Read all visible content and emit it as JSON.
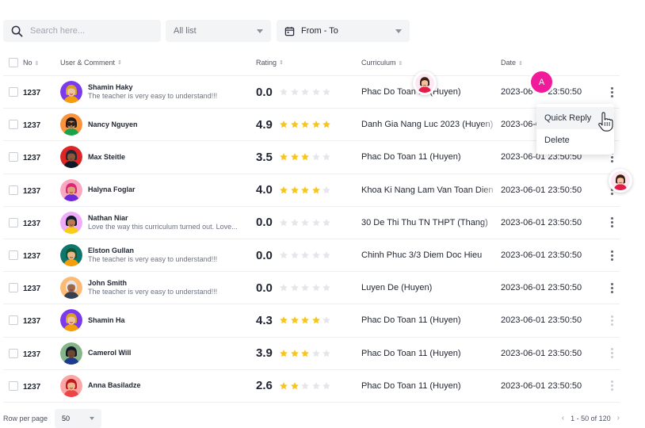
{
  "filters": {
    "search_placeholder": "Search here...",
    "list_select": "All list",
    "date_range": "From - To"
  },
  "columns": {
    "no": "No",
    "user": "User & Comment",
    "rating": "Rating",
    "curriculum": "Curriculum",
    "date": "Date"
  },
  "rows": [
    {
      "no": "1237",
      "name": "Shamin Haky",
      "comment": "The teacher is very easy to understand!!!",
      "rating": "0.0",
      "stars": 0,
      "curriculum": "Phac Do Toan 11 (Huyen)",
      "date": "2023-06-01 23:50:50",
      "avatar": "a1"
    },
    {
      "no": "1237",
      "name": "Nancy Nguyen",
      "comment": "",
      "rating": "4.9",
      "stars": 5,
      "curriculum": "Danh Gia Nang Luc 2023 (Huyen)",
      "date": "2023-06-01 23:50:50",
      "avatar": "a2"
    },
    {
      "no": "1237",
      "name": "Max Steitle",
      "comment": "",
      "rating": "3.5",
      "stars": 3,
      "curriculum": "Phac Do Toan 11 (Huyen)",
      "date": "2023-06-01 23:50:50",
      "avatar": "a3"
    },
    {
      "no": "1237",
      "name": "Halyna Foglar",
      "comment": "",
      "rating": "4.0",
      "stars": 4,
      "curriculum": "Khoa Ki Nang Lam Van Toan Dien",
      "date": "2023-06-01 23:50:50",
      "avatar": "a4"
    },
    {
      "no": "1237",
      "name": "Nathan Niar",
      "comment": "Love the way this curriculum turned out. Love...",
      "rating": "0.0",
      "stars": 0,
      "curriculum": "30 De Thi Thu TN THPT (Thang)",
      "date": "2023-06-01 23:50:50",
      "avatar": "a5"
    },
    {
      "no": "1237",
      "name": "Elston Gullan",
      "comment": "The teacher is very easy to understand!!!",
      "rating": "0.0",
      "stars": 0,
      "curriculum": "Chinh Phuc 3/3 Diem Doc Hieu",
      "date": "2023-06-01 23:50:50",
      "avatar": "a6"
    },
    {
      "no": "1237",
      "name": "John Smith",
      "comment": "The teacher is very easy to understand!!!",
      "rating": "0.0",
      "stars": 0,
      "curriculum": "Luyen De (Huyen)",
      "date": "2023-06-01 23:50:50",
      "avatar": "a7"
    },
    {
      "no": "1237",
      "name": "Shamin Ha",
      "comment": "",
      "rating": "4.3",
      "stars": 4,
      "curriculum": "Phac Do Toan 11 (Huyen)",
      "date": "2023-06-01 23:50:50",
      "avatar": "a1"
    },
    {
      "no": "1237",
      "name": "Camerol Will",
      "comment": "",
      "rating": "3.9",
      "stars": 3,
      "curriculum": "Phac Do Toan 11 (Huyen)",
      "date": "2023-06-01 23:50:50",
      "avatar": "a8"
    },
    {
      "no": "1237",
      "name": "Anna Basiladze",
      "comment": "",
      "rating": "2.6",
      "stars": 2,
      "curriculum": "Phac Do Toan 11 (Huyen)",
      "date": "2023-06-01 23:50:50",
      "avatar": "a9"
    }
  ],
  "context_menu": {
    "quick_reply": "Quick Reply",
    "delete": "Delete"
  },
  "cursor_user_initial": "A",
  "footer": {
    "rows_per_page_label": "Row per page",
    "rows_per_page_value": "50",
    "range": "1 - 50 of 120"
  },
  "colors": {
    "star_filled": "#f7c51e",
    "star_empty": "#e4e6ea",
    "cursor_avatar": "#f01a9b"
  }
}
